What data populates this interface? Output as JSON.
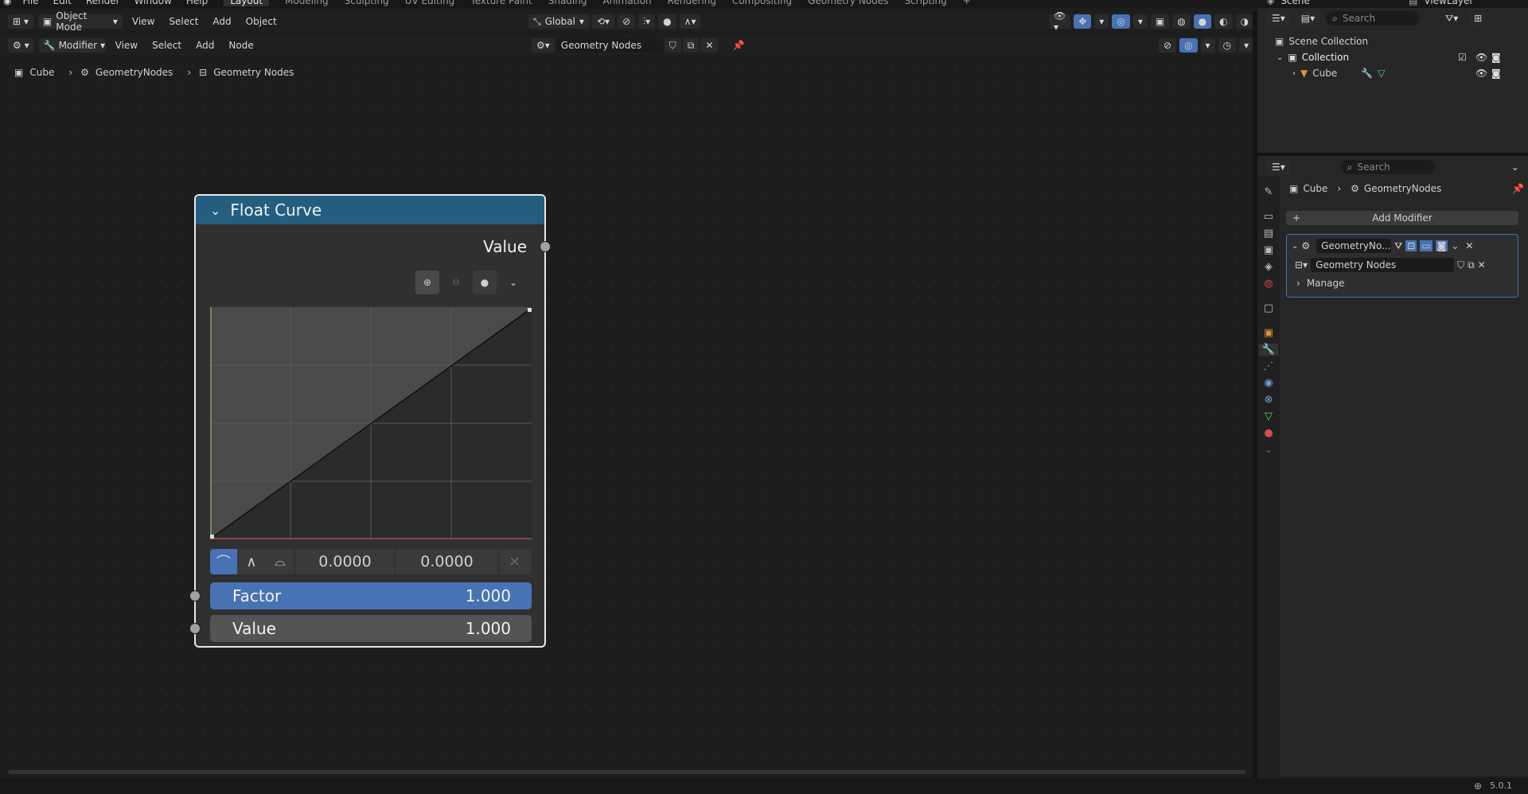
{
  "topbar": {
    "menus": [
      "File",
      "Edit",
      "Render",
      "Window",
      "Help"
    ],
    "workspaces": [
      "Layout",
      "Modeling",
      "Sculpting",
      "UV Editing",
      "Texture Paint",
      "Shading",
      "Animation",
      "Rendering",
      "Compositing",
      "Geometry Nodes",
      "Scripting"
    ],
    "active_workspace": "Layout",
    "scene": "Scene",
    "view_layer": "ViewLayer"
  },
  "viewport_header": {
    "mode": "Object Mode",
    "menus": [
      "View",
      "Select",
      "Add",
      "Object"
    ],
    "transform_orientation": "Global"
  },
  "node_header": {
    "editor_type": "Modifier",
    "menus": [
      "View",
      "Select",
      "Add",
      "Node"
    ],
    "node_group": "Geometry Nodes"
  },
  "breadcrumb": [
    "Cube",
    "GeometryNodes",
    "Geometry Nodes"
  ],
  "node": {
    "title": "Float Curve",
    "output_label": "Value",
    "point_x": "0.0000",
    "point_y": "0.0000",
    "inputs": [
      {
        "label": "Factor",
        "value": "1.000"
      },
      {
        "label": "Value",
        "value": "1.000"
      }
    ],
    "colors": {
      "header": "#235e7f",
      "factor_field": "#4772b3",
      "value_field": "#545454"
    }
  },
  "outliner": {
    "search_placeholder": "Search",
    "root": "Scene Collection",
    "collection": "Collection",
    "object": "Cube"
  },
  "properties": {
    "search_placeholder": "Search",
    "breadcrumb": [
      "Cube",
      "GeometryNodes"
    ],
    "add_modifier": "Add Modifier",
    "modifier_name": "GeometryNo...",
    "node_group": "Geometry Nodes",
    "manage": "Manage"
  },
  "status": {
    "version": "5.0.1"
  }
}
